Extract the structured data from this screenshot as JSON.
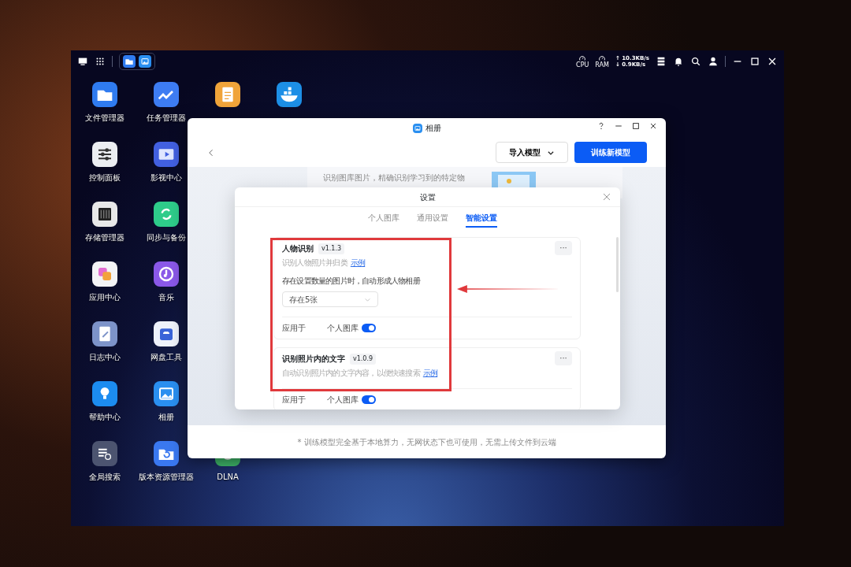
{
  "top_bar": {
    "taskbar_apps": [
      {
        "kind": "folder"
      },
      {
        "kind": "photos"
      }
    ],
    "cpu_label": "CPU",
    "ram_label": "RAM",
    "upload_speed": "↑ 10.3KB/s",
    "download_speed": "↓ 0.9KB/s"
  },
  "desktop_columns": [
    [
      {
        "kind": "folder",
        "label": "文件管理器"
      },
      {
        "kind": "sliders",
        "label": "控制面板"
      },
      {
        "kind": "storage",
        "label": "存储管理器"
      },
      {
        "kind": "apps",
        "label": "应用中心"
      },
      {
        "kind": "notebook",
        "label": "日志中心"
      },
      {
        "kind": "bulb",
        "label": "帮助中心"
      },
      {
        "kind": "search",
        "label": "全局搜索"
      }
    ],
    [
      {
        "kind": "chart",
        "label": "任务管理器"
      },
      {
        "kind": "video",
        "label": "影视中心"
      },
      {
        "kind": "sync",
        "label": "同步与备份"
      },
      {
        "kind": "music",
        "label": "音乐"
      },
      {
        "kind": "cloud",
        "label": "网盘工具"
      },
      {
        "kind": "photos",
        "label": "相册"
      },
      {
        "kind": "history",
        "label": "版本资源管理器"
      }
    ],
    [
      {
        "kind": "notes"
      },
      {
        "kind": "dlna",
        "label": "DLNA"
      }
    ],
    [
      {
        "kind": "containers"
      }
    ]
  ],
  "app_window": {
    "title": "相册",
    "import_button": "导入模型",
    "train_button": "训练新模型",
    "intro_text": "识别图库图片，精确识别学习到的特定物",
    "footer_note": "* 训练模型完全基于本地算力，无网状态下也可使用，无需上传文件到云端",
    "settings_dialog": {
      "title": "设置",
      "tabs": [
        {
          "label": "个人图库",
          "selected": false
        },
        {
          "label": "通用设置",
          "selected": false
        },
        {
          "label": "智能设置",
          "selected": true
        }
      ],
      "features": [
        {
          "name": "人物识别",
          "version": "v1.1.3",
          "description": "识别人物照片并归类",
          "example_link": "示例",
          "more_label": "···",
          "option_label": "存在设置数量的图片时，自动形成人物相册",
          "option_value": "存在5张",
          "apply_label": "应用于",
          "apply_target": "个人图库",
          "on": true
        },
        {
          "name": "识别照片内的文字",
          "version": "v1.0.9",
          "description": "自动识别照片内的文字内容，以便快速搜索",
          "example_link": "示例",
          "more_label": "···",
          "apply_label": "应用于",
          "apply_target": "个人图库",
          "on": true
        }
      ]
    }
  }
}
